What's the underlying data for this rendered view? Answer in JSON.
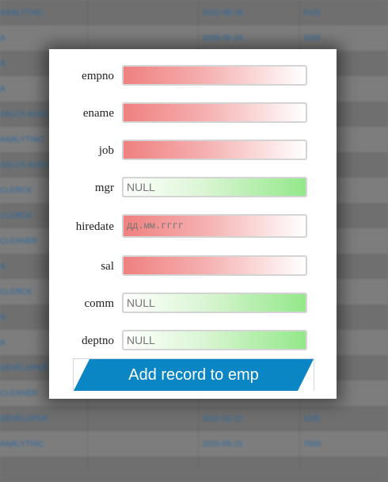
{
  "background_table": {
    "rows": [
      {
        "c1": "ANALYTHIC",
        "c2": "2022-08-18",
        "c3": "6105"
      },
      {
        "c1": "A",
        "c2": "2009-06-24",
        "c3": "2005"
      },
      {
        "c1": "A",
        "c2": "",
        "c3": ""
      },
      {
        "c1": "A",
        "c2": "",
        "c3": ""
      },
      {
        "c1": "SALES ASSIST",
        "c2": "",
        "c3": ""
      },
      {
        "c1": "ANALYTHIC",
        "c2": "",
        "c3": ""
      },
      {
        "c1": "SALES ASSIST",
        "c2": "",
        "c3": ""
      },
      {
        "c1": "CLERCK",
        "c2": "",
        "c3": ""
      },
      {
        "c1": "CLERCK",
        "c2": "",
        "c3": ""
      },
      {
        "c1": "CLEANER",
        "c2": "",
        "c3": ""
      },
      {
        "c1": "A",
        "c2": "",
        "c3": ""
      },
      {
        "c1": "CLERCK",
        "c2": "",
        "c3": ""
      },
      {
        "c1": "A",
        "c2": "",
        "c3": ""
      },
      {
        "c1": "A",
        "c2": "",
        "c3": ""
      },
      {
        "c1": "DEVELOPER",
        "c2": "",
        "c3": ""
      },
      {
        "c1": "CLEANER",
        "c2": "",
        "c3": ""
      },
      {
        "c1": "DEVELOPER",
        "c2": "2012-03-12",
        "c3": "1105"
      },
      {
        "c1": "ANALYTHIC",
        "c2": "2010-09-15",
        "c3": "7600"
      },
      {
        "c1": "",
        "c2": "",
        "c3": ""
      }
    ]
  },
  "form": {
    "fields": [
      {
        "label": "empno",
        "value": "",
        "placeholder": "",
        "kind": "required"
      },
      {
        "label": "ename",
        "value": "",
        "placeholder": "",
        "kind": "required"
      },
      {
        "label": "job",
        "value": "",
        "placeholder": "",
        "kind": "required"
      },
      {
        "label": "mgr",
        "value": "",
        "placeholder": "NULL",
        "kind": "optional"
      },
      {
        "label": "hiredate",
        "value": "",
        "placeholder": "дд.мм.гггг",
        "kind": "date"
      },
      {
        "label": "sal",
        "value": "",
        "placeholder": "",
        "kind": "required"
      },
      {
        "label": "comm",
        "value": "",
        "placeholder": "NULL",
        "kind": "optional"
      },
      {
        "label": "deptno",
        "value": "",
        "placeholder": "NULL",
        "kind": "optional"
      }
    ],
    "submit_label": "Add record to emp"
  },
  "colors": {
    "required_gradient_start": "#f08080",
    "optional_gradient_end": "#93e88a",
    "button": "#0a86c4"
  }
}
